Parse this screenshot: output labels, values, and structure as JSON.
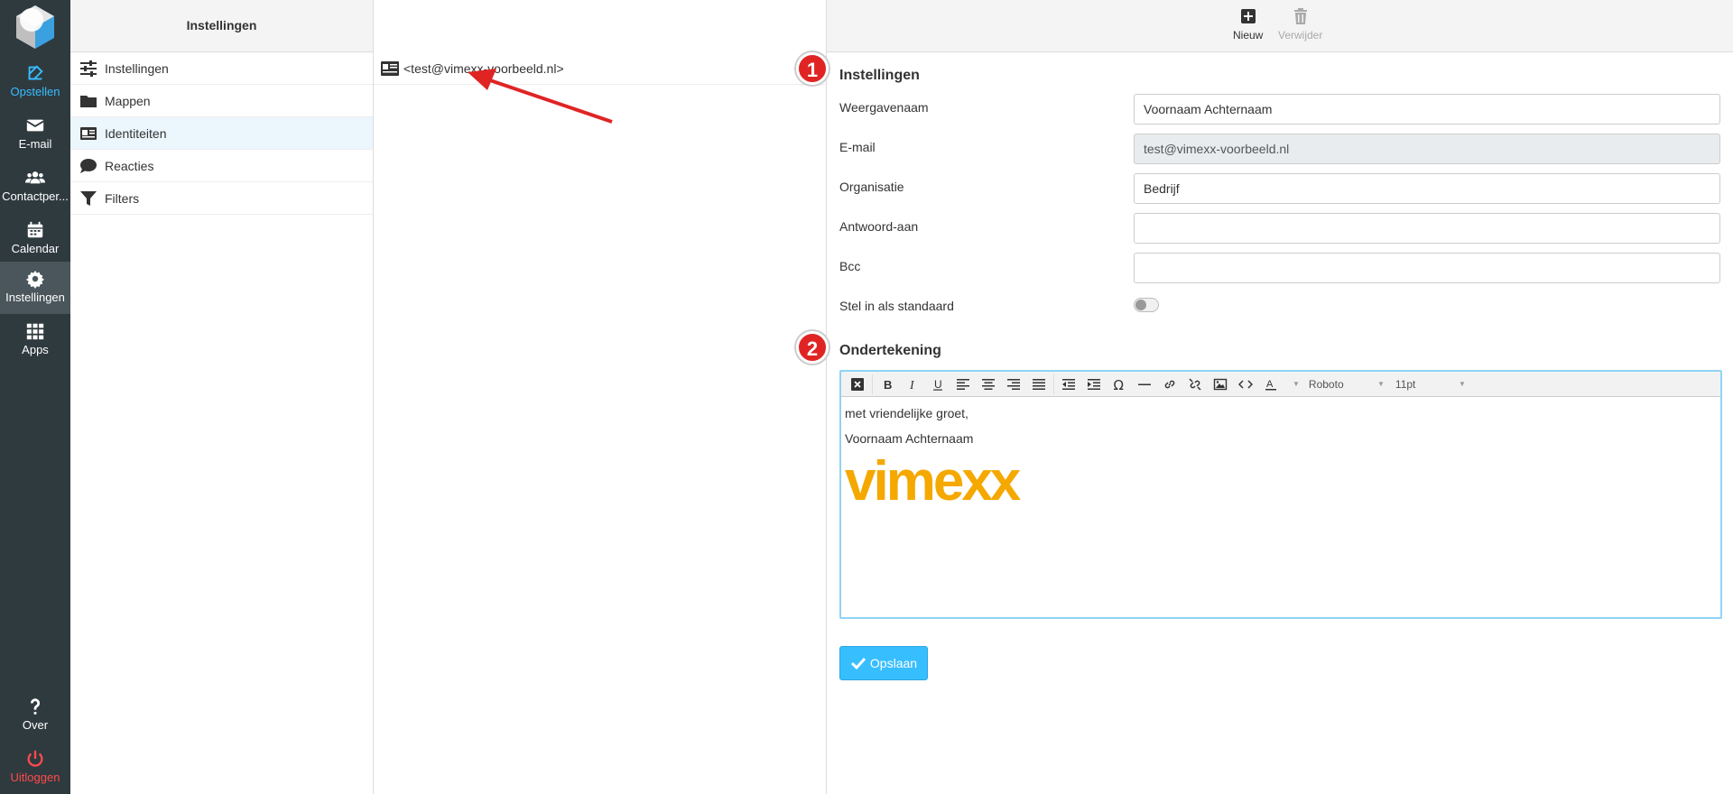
{
  "nav": {
    "items": [
      {
        "label": "Opstellen",
        "icon": "compose-icon"
      },
      {
        "label": "E-mail",
        "icon": "mail-icon"
      },
      {
        "label": "Contactper...",
        "icon": "contacts-icon"
      },
      {
        "label": "Calendar",
        "icon": "calendar-icon"
      },
      {
        "label": "Instellingen",
        "icon": "gear-icon"
      },
      {
        "label": "Apps",
        "icon": "apps-grid-icon"
      }
    ],
    "bottom": [
      {
        "label": "Over",
        "icon": "question-icon"
      },
      {
        "label": "Uitloggen",
        "icon": "power-icon"
      }
    ]
  },
  "settings": {
    "header": "Instellingen",
    "items": [
      {
        "label": "Instellingen",
        "icon": "sliders-icon"
      },
      {
        "label": "Mappen",
        "icon": "folder-icon"
      },
      {
        "label": "Identiteiten",
        "icon": "id-card-icon"
      },
      {
        "label": "Reacties",
        "icon": "speech-bubble-icon"
      },
      {
        "label": "Filters",
        "icon": "filter-icon"
      }
    ]
  },
  "identities": {
    "items": [
      {
        "label": "<test@vimexx-voorbeeld.nl>",
        "icon": "id-card-icon"
      }
    ]
  },
  "toolbar": {
    "new_label": "Nieuw",
    "delete_label": "Verwijder"
  },
  "form": {
    "section_title": "Instellingen",
    "badge1": "1",
    "badge2": "2",
    "display_name_label": "Weergavenaam",
    "display_name_value": "Voornaam Achternaam",
    "email_label": "E-mail",
    "email_value": "test@vimexx-voorbeeld.nl",
    "organisation_label": "Organisatie",
    "organisation_value": "Bedrijf",
    "reply_to_label": "Antwoord-aan",
    "reply_to_value": "",
    "bcc_label": "Bcc",
    "bcc_value": "",
    "default_label": "Stel in als standaard",
    "default_on": false
  },
  "signature": {
    "section_title": "Ondertekening",
    "font": "Roboto",
    "size": "11pt",
    "line1": "met vriendelijke groet,",
    "line2": "Voornaam Achternaam",
    "logo_text": "vimexx"
  },
  "save_label": "Opslaan",
  "colors": {
    "nav_bg": "#2f3a3f",
    "accent": "#37beff",
    "badge": "#e02424",
    "logout": "#ff4b4b",
    "logo": "#f5a800"
  }
}
